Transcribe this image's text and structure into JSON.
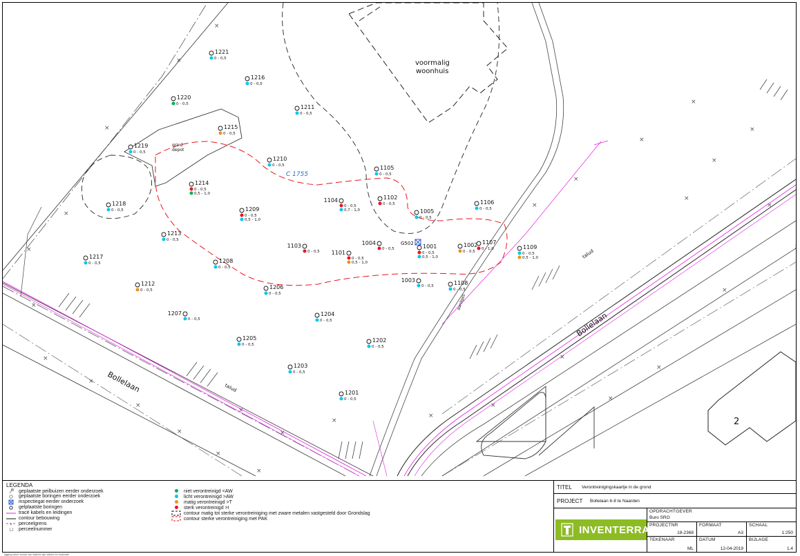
{
  "map": {
    "building_label": "voormalig\nwoonhuis",
    "depot_label": "grind\ndepot",
    "contour_label": "C 1755",
    "street_labels": [
      "Bollelaan",
      "Bollelaan"
    ],
    "talud_labels": [
      "talud",
      "talud"
    ],
    "parcel_number": "2",
    "colors": {
      "niet": "#00b050",
      "licht": "#00c8ee",
      "matig": "#f0901a",
      "sterk": "#e8141e",
      "contour_red": "#e8141e",
      "cable": "#e020e0"
    },
    "points": [
      {
        "id": "1221",
        "samples": [
          {
            "depth": "0 - 0,5",
            "level": "licht"
          }
        ]
      },
      {
        "id": "1216",
        "samples": [
          {
            "depth": "0 - 0,5",
            "level": "licht"
          }
        ]
      },
      {
        "id": "1220",
        "samples": [
          {
            "depth": "0 - 0,5",
            "level": "niet"
          }
        ]
      },
      {
        "id": "1211",
        "samples": [
          {
            "depth": "0 - 0,5",
            "level": "licht"
          }
        ]
      },
      {
        "id": "1215",
        "samples": [
          {
            "depth": "0 - 0,5",
            "level": "matig"
          }
        ]
      },
      {
        "id": "1219",
        "samples": [
          {
            "depth": "0 - 0,5",
            "level": "licht"
          }
        ]
      },
      {
        "id": "1210",
        "samples": [
          {
            "depth": "0 - 0,5",
            "level": "licht"
          }
        ]
      },
      {
        "id": "1105",
        "samples": [
          {
            "depth": "0 - 0,5",
            "level": "licht"
          }
        ]
      },
      {
        "id": "1214",
        "samples": [
          {
            "depth": "0 - 0,5",
            "level": "sterk"
          },
          {
            "depth": "0,5 - 1,0",
            "level": "niet"
          }
        ]
      },
      {
        "id": "1218",
        "samples": [
          {
            "depth": "0 - 0,5",
            "level": "licht"
          }
        ]
      },
      {
        "id": "1104",
        "samples": [
          {
            "depth": "0 - 0,5",
            "level": "sterk"
          },
          {
            "depth": "0,7 - 1,0",
            "level": "licht"
          }
        ]
      },
      {
        "id": "1102",
        "samples": [
          {
            "depth": "0 - 0,5",
            "level": "sterk"
          }
        ]
      },
      {
        "id": "1005",
        "samples": [
          {
            "depth": "0 - 0,5",
            "level": "licht"
          }
        ]
      },
      {
        "id": "1106",
        "samples": [
          {
            "depth": "0 - 0,5",
            "level": "licht"
          }
        ]
      },
      {
        "id": "1209",
        "samples": [
          {
            "depth": "0 - 0,5",
            "level": "sterk"
          },
          {
            "depth": "0,5 - 1,0",
            "level": "licht"
          }
        ]
      },
      {
        "id": "1213",
        "samples": [
          {
            "depth": "0 - 0,5",
            "level": "licht"
          }
        ]
      },
      {
        "id": "1103",
        "samples": [
          {
            "depth": "0 - 0,5",
            "level": "sterk"
          }
        ]
      },
      {
        "id": "1004",
        "samples": [
          {
            "depth": "0 - 0,5",
            "level": "sterk"
          }
        ]
      },
      {
        "id": "1001",
        "samples": [
          {
            "depth": "0 - 0,5",
            "level": "sterk"
          },
          {
            "depth": "0,5 - 1,0",
            "level": "licht"
          }
        ]
      },
      {
        "id": "1002",
        "samples": [
          {
            "depth": "0 - 0,5",
            "level": "matig"
          }
        ]
      },
      {
        "id": "1107",
        "samples": [
          {
            "depth": "0 - 1,0",
            "level": "sterk"
          }
        ]
      },
      {
        "id": "1109",
        "samples": [
          {
            "depth": "0 - 0,5",
            "level": "licht"
          },
          {
            "depth": "0,5 - 1,0",
            "level": "matig"
          }
        ]
      },
      {
        "id": "1101",
        "samples": [
          {
            "depth": "0 - 0,5",
            "level": "sterk"
          },
          {
            "depth": "0,5 - 1,0",
            "level": "matig"
          }
        ]
      },
      {
        "id": "1217",
        "samples": [
          {
            "depth": "0 - 0,5",
            "level": "licht"
          }
        ]
      },
      {
        "id": "1208",
        "samples": [
          {
            "depth": "0 - 0,5",
            "level": "licht"
          }
        ]
      },
      {
        "id": "1003",
        "samples": [
          {
            "depth": "0 - 0,5",
            "level": "licht"
          }
        ]
      },
      {
        "id": "1108",
        "samples": [
          {
            "depth": "0 - 0,5",
            "level": "licht"
          }
        ]
      },
      {
        "id": "1212",
        "samples": [
          {
            "depth": "0 - 0,5",
            "level": "matig"
          }
        ]
      },
      {
        "id": "1206",
        "samples": [
          {
            "depth": "0 - 0,5",
            "level": "licht"
          }
        ]
      },
      {
        "id": "1207",
        "samples": [
          {
            "depth": "0 - 0,5",
            "level": "licht"
          }
        ]
      },
      {
        "id": "1204",
        "samples": [
          {
            "depth": "0 - 0,5",
            "level": "licht"
          }
        ]
      },
      {
        "id": "1202",
        "samples": [
          {
            "depth": "0 - 0,5",
            "level": "licht"
          }
        ]
      },
      {
        "id": "1205",
        "samples": [
          {
            "depth": "0 - 0,5",
            "level": "licht"
          }
        ]
      },
      {
        "id": "1203",
        "samples": [
          {
            "depth": "0 - 0,5",
            "level": "licht"
          }
        ]
      },
      {
        "id": "1201",
        "samples": [
          {
            "depth": "0 - 0,5",
            "level": "licht"
          }
        ]
      }
    ],
    "peilbuis_label": "G502"
  },
  "legend": {
    "title": "LEGENDA",
    "col1": [
      {
        "label": "geplaatste peilbuizen eerder onderzoek",
        "icon": "peilbuis-icon"
      },
      {
        "label": "geplaatste boringen eerder onderzoek",
        "icon": "boring-icon"
      },
      {
        "label": "inspectiegat eerder onderzoek",
        "icon": "inspectiegat-icon"
      },
      {
        "label": "gelplaatste boringen",
        "icon": "boring-new-icon"
      },
      {
        "label": "tracé kabels en leidingen",
        "icon": "cable-line-icon"
      },
      {
        "label": "contour bebouwing",
        "icon": "building-line-icon"
      },
      {
        "label": "perceelgrens",
        "icon": "parcel-line-icon"
      },
      {
        "label": "perceelnummer",
        "icon": "parcel-number-icon"
      }
    ],
    "col2": [
      {
        "label": "niet verontreinigd <AW",
        "level": "niet"
      },
      {
        "label": "licht verontreinigd >AW",
        "level": "licht"
      },
      {
        "label": "matig verontreinigd >T",
        "level": "matig"
      },
      {
        "label": "sterk verontreinigd >I",
        "level": "sterk"
      },
      {
        "label": "contour matig tot sterke verontreiniging met zware metalen vastgesteld door Grondslag",
        "level": "contour-black"
      },
      {
        "label": "contour sterke verontreiniging met PAK",
        "level": "contour-red"
      }
    ]
  },
  "titleblock": {
    "titel_label": "TITEL",
    "titel_value": "Verontreinigingskaartje in de grond",
    "project_label": "PROJECT",
    "project_value": "Bollelaan 6-8 te Naarden",
    "opdrachtgever_label": "OPDRACHTGEVER",
    "opdrachtgever_value": "Buro SRO",
    "projectnr_label": "PROJECTNR",
    "projectnr_value": "18-2368",
    "formaat_label": "FORMAAT",
    "formaat_value": "A3",
    "schaal_label": "SCHAAL",
    "schaal_value": "1:250",
    "tekenaar_label": "TEKENAAR",
    "tekenaar_value": "ML",
    "datum_label": "DATUM",
    "datum_value": "12-04-2019",
    "bijlage_label": "BIJLAGE",
    "bijlage_value": "1.4",
    "company": "INVENTERRA"
  },
  "footer_note": "ligging deze versie van kabels zijn alleen ter indicatie"
}
